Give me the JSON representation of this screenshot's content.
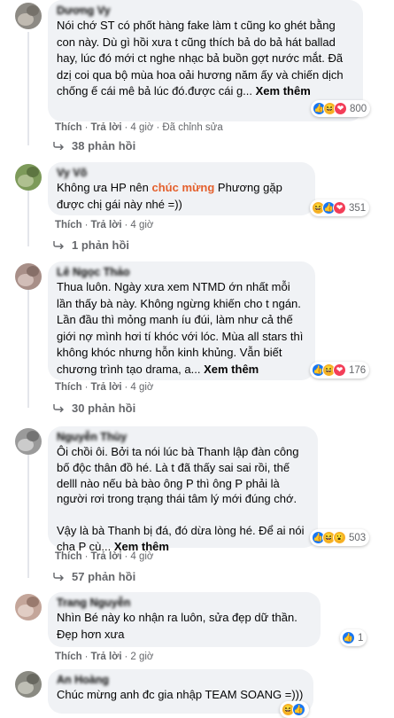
{
  "comments": [
    {
      "author": "Dương Vy",
      "text": "Nói chớ ST có phốt hàng fake làm t cũng ko ghét bằng con này. Dù gì hồi xưa t cũng thích bả do bả hát ballad hay, lúc đó mới ct nghe nhạc bả buồn gợt nước mắt. Đã dzị coi qua bộ mùa hoa oải hương năm ấy và chiến dịch chống ế cái mê bả lúc đó.được cái g...",
      "see_more": "Xem thêm",
      "reactions": [
        "like",
        "haha",
        "love"
      ],
      "reaction_count": "800",
      "like_label": "Thích",
      "reply_label": "Trả lời",
      "time": "4 giờ",
      "edited": "Đã chỉnh sửa",
      "replies": "38 phản hồi",
      "avatar_colors": [
        "#8d8a84",
        "#c9c2b8",
        "#6f6a64"
      ]
    },
    {
      "author": "Vy Võ",
      "text_before": "Không ưa HP nên ",
      "highlight": "chúc mừng",
      "text_after": " Phương gặp được chị gái này nhé =))",
      "reactions": [
        "haha",
        "like",
        "love"
      ],
      "reaction_count": "351",
      "like_label": "Thích",
      "reply_label": "Trả lời",
      "time": "4 giờ",
      "replies": "1 phản hồi",
      "avatar_colors": [
        "#7d9a5a",
        "#b7c79a",
        "#556b3b"
      ]
    },
    {
      "author": "Lê Ngọc Thảo",
      "text": "Thua luôn. Ngày xưa xem NTMD ớn nhất mỗi lần thấy bà này. Không ngừng khiến cho t ngán. Lần đầu thì mỏng manh íu đúi, làm như cả thế giới nợ mình hơi tí khóc với lóc. Mùa all stars thì không khóc nhưng hỗn kinh khủng. Vẫn biết chương trình tạo drama, a...",
      "see_more": "Xem thêm",
      "reactions": [
        "like",
        "haha",
        "love"
      ],
      "reaction_count": "176",
      "like_label": "Thích",
      "reply_label": "Trả lời",
      "time": "4 giờ",
      "replies": "30 phản hồi",
      "avatar_colors": [
        "#a88f88",
        "#d8c5c0",
        "#7d6660"
      ]
    },
    {
      "author": "Nguyễn Thùy",
      "text": "Ôi chồi ôi. Bởi ta nói lúc bà Thanh lập đàn công bố độc thân đồ hé. Là t đã thấy sai sai rồi, thế delll nào nếu bà bào ông P thì ông P phải là người rơi trong trạng thái tâm lý mới đúng chớ.\n\nVậy là bà Thanh bị đá, đó dừa lòng hé. Để ai nói cha P cù...",
      "see_more": "Xem thêm",
      "reactions": [
        "like",
        "haha",
        "wow"
      ],
      "reaction_count": "503",
      "like_label": "Thích",
      "reply_label": "Trả lời",
      "time": "4 giờ",
      "replies": "57 phản hồi",
      "avatar_colors": [
        "#9a9a9a",
        "#d4d4d4",
        "#6a6a6a"
      ]
    },
    {
      "author": "Trang Nguyễn",
      "text": "Nhìn Bé này ko nhận ra luôn, sửa đẹp dữ thần. Đẹp hơn xưa",
      "reactions": [
        "like"
      ],
      "reaction_count": "1",
      "like_label": "Thích",
      "reply_label": "Trả lời",
      "time": "2 giờ",
      "avatar_colors": [
        "#c4a69a",
        "#e6d3cb",
        "#8f6f63"
      ]
    },
    {
      "author": "An Hoàng",
      "text": "Chúc mừng anh đc gia nhập TEAM SOANG =)))",
      "reactions": [
        "haha",
        "like"
      ],
      "avatar_colors": [
        "#8a8a82",
        "#c8c8be",
        "#5f5f58"
      ]
    }
  ]
}
